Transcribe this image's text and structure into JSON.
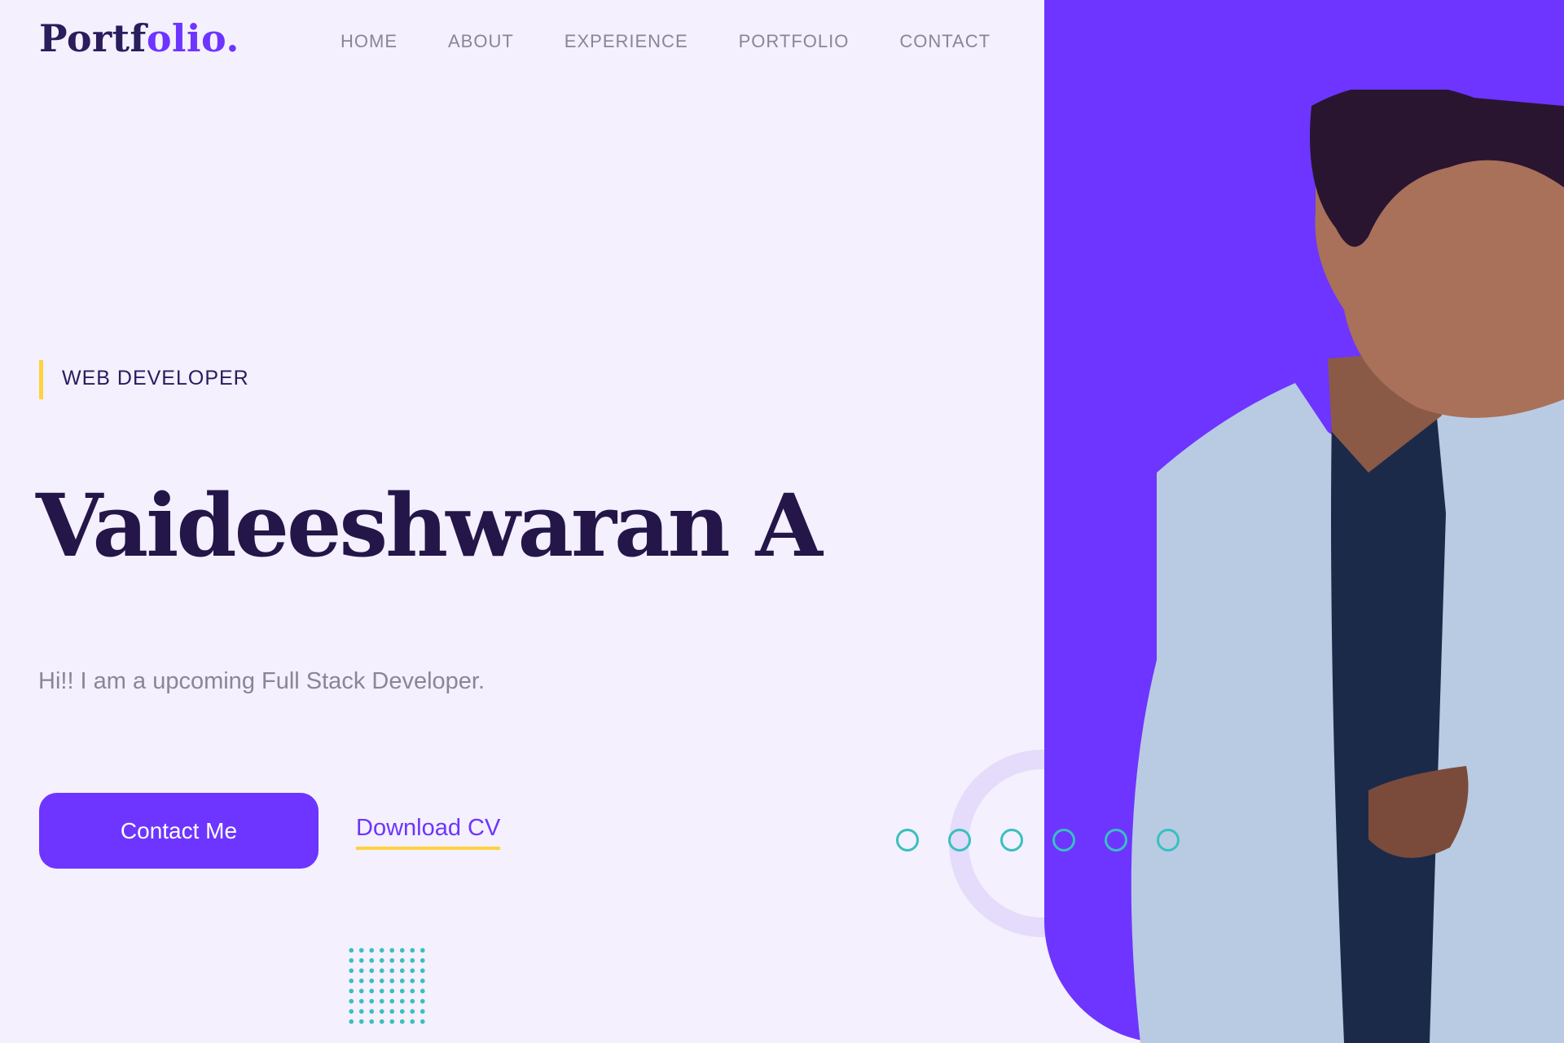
{
  "logo": {
    "text_main": "Portf",
    "text_accent": "olio."
  },
  "nav": {
    "items": [
      "HOME",
      "ABOUT",
      "EXPERIENCE",
      "PORTFOLIO",
      "CONTACT"
    ]
  },
  "hero": {
    "role": "WEB DEVELOPER",
    "name": "Vaideeshwaran A",
    "tagline": "Hi!! I am a upcoming Full Stack Developer.",
    "contact_button": "Contact Me",
    "download_link": "Download CV"
  },
  "colors": {
    "accent": "#6d35ff",
    "dark_text": "#241648",
    "highlight": "#ffd23f",
    "teal": "#38c0c0",
    "background": "#f4f0fd"
  },
  "slider": {
    "dot_count": 6
  }
}
